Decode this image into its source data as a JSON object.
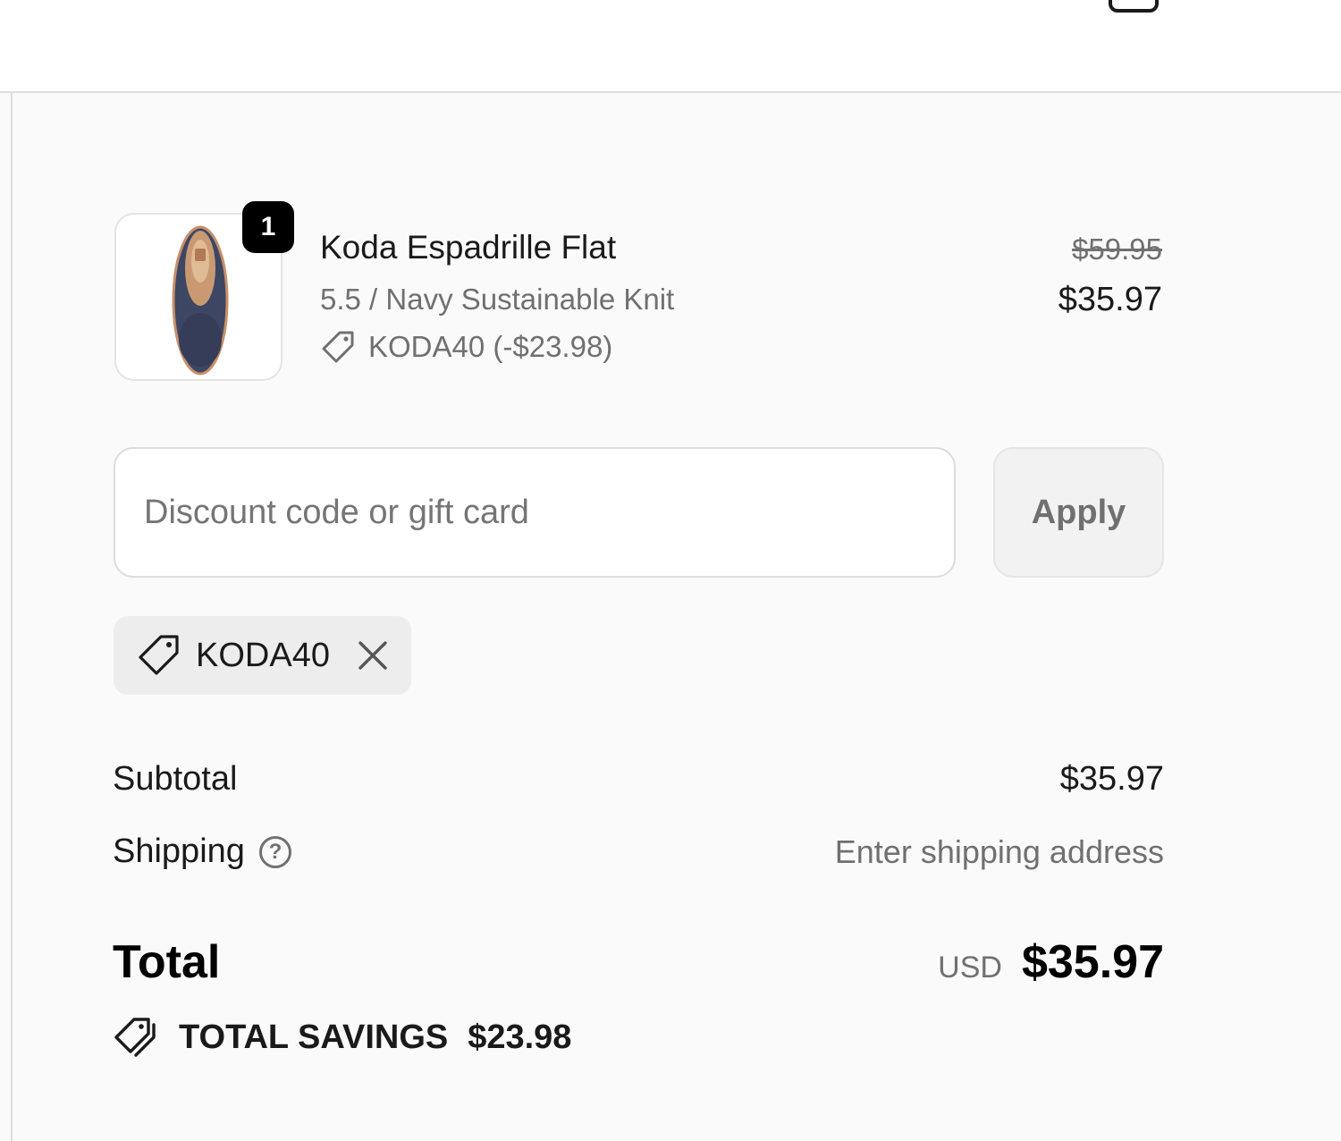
{
  "line_item": {
    "quantity": "1",
    "name": "Koda Espadrille Flat",
    "variant": "5.5 / Navy Sustainable Knit",
    "discount_text": "KODA40 (-$23.98)",
    "original_price": "$59.95",
    "price": "$35.97"
  },
  "discount": {
    "placeholder": "Discount code or gift card",
    "value": "",
    "apply_label": "Apply",
    "applied_code": "KODA40"
  },
  "totals": {
    "subtotal_label": "Subtotal",
    "subtotal_value": "$35.97",
    "shipping_label": "Shipping",
    "shipping_value": "Enter shipping address",
    "help_glyph": "?",
    "total_label": "Total",
    "currency": "USD",
    "total_value": "$35.97",
    "savings_label": "TOTAL SAVINGS",
    "savings_value": "$23.98"
  },
  "icons": {
    "tag": "tag-icon",
    "remove": "close-icon",
    "help": "question-circle-icon",
    "savings": "tags-icon",
    "bag": "bag-icon"
  },
  "colors": {
    "panel_bg": "#fafafa",
    "text": "#1a1a1a",
    "muted": "#707070",
    "badge_bg": "#000000"
  }
}
